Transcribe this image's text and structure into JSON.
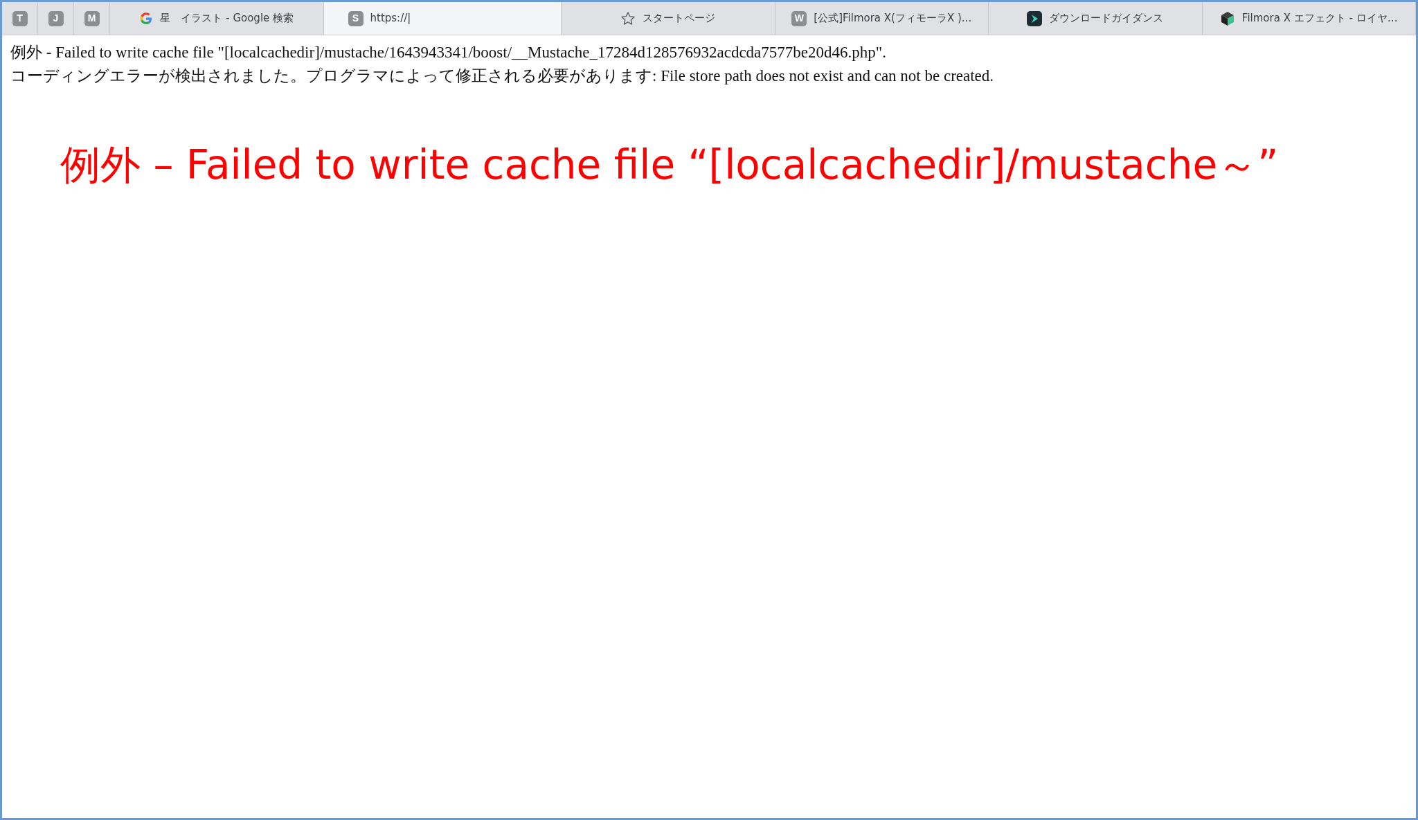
{
  "tabs": [
    {
      "kind": "pinned",
      "badge": "T",
      "selected": false
    },
    {
      "kind": "pinned",
      "badge": "J",
      "selected": false
    },
    {
      "kind": "pinned",
      "badge": "M",
      "selected": false
    },
    {
      "kind": "tab",
      "title": "星　イラスト - Google 検索",
      "selected": false
    },
    {
      "kind": "tab",
      "badge": "S",
      "title": "https://|",
      "selected": true
    },
    {
      "kind": "tab",
      "title": "スタートページ",
      "selected": false
    },
    {
      "kind": "tab",
      "badge": "W",
      "title": "[公式]Filmora X(フィモーラX )...",
      "selected": false
    },
    {
      "kind": "tab",
      "title": "ダウンロードガイダンス",
      "selected": false
    },
    {
      "kind": "tab",
      "title": "Filmora X エフェクト - ロイヤ…",
      "selected": false
    }
  ],
  "error_lines": [
    "例外 - Failed to write cache file \"[localcachedir]/mustache/1643943341/boost/__Mustache_17284d128576932acdcda7577be20d46.php\".",
    "コーディングエラーが検出されました。プログラマによって修正される必要があります: File store path does not exist and can not be created."
  ],
  "caption": "例外 – Failed to write cache file “[localcachedir]/mustache～”"
}
